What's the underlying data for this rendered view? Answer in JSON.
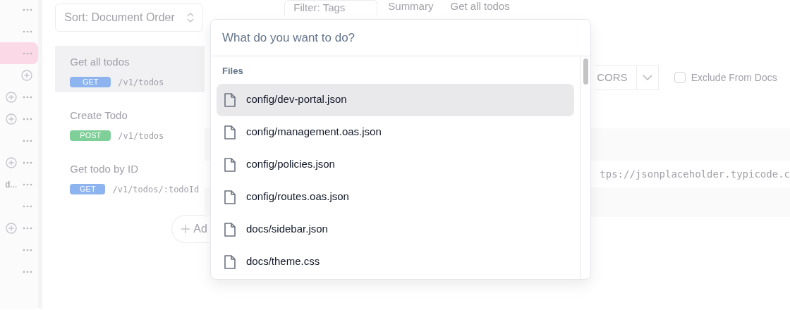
{
  "sidebar": {
    "items": [
      {
        "add": false,
        "dots": true,
        "selected": false
      },
      {
        "add": false,
        "dots": true,
        "selected": false
      },
      {
        "add": false,
        "dots": true,
        "selected": true
      },
      {
        "add": true,
        "dots": false,
        "selected": false
      },
      {
        "add": true,
        "dots": true,
        "selected": false
      },
      {
        "add": true,
        "dots": true,
        "selected": false
      },
      {
        "add": false,
        "dots": true,
        "selected": false
      },
      {
        "add": true,
        "dots": true,
        "selected": false
      },
      {
        "label": "d...",
        "add": false,
        "dots": true,
        "selected": false
      },
      {
        "add": false,
        "dots": true,
        "selected": false
      },
      {
        "add": true,
        "dots": true,
        "selected": false
      },
      {
        "add": false,
        "dots": true,
        "selected": false
      },
      {
        "add": false,
        "dots": true,
        "selected": false
      }
    ]
  },
  "operations": {
    "sort": "Sort: Document Order",
    "filter": "Filter: Tags",
    "add_button": "Ad",
    "items": [
      {
        "title": "Get all todos",
        "method": "GET",
        "path": "/v1/todos",
        "selected": true
      },
      {
        "title": "Create Todo",
        "method": "POST",
        "path": "/v1/todos",
        "selected": false
      },
      {
        "title": "Get todo by ID",
        "method": "GET",
        "path": "/v1/todos/:todoId",
        "selected": false
      }
    ]
  },
  "detail": {
    "breadcrumb": [
      "Summary",
      "Get all todos"
    ],
    "cors": "CORS",
    "exclude_label": "Exclude From Docs",
    "exclude_checked": false,
    "url": "tps://jsonplaceholder.typicode.c"
  },
  "palette": {
    "placeholder": "What do you want to do?",
    "section": "Files",
    "items": [
      {
        "label": "config/dev-portal.json",
        "selected": true
      },
      {
        "label": "config/management.oas.json",
        "selected": false
      },
      {
        "label": "config/policies.json",
        "selected": false
      },
      {
        "label": "config/routes.oas.json",
        "selected": false
      },
      {
        "label": "docs/sidebar.json",
        "selected": false
      },
      {
        "label": "docs/theme.css",
        "selected": false
      }
    ]
  }
}
